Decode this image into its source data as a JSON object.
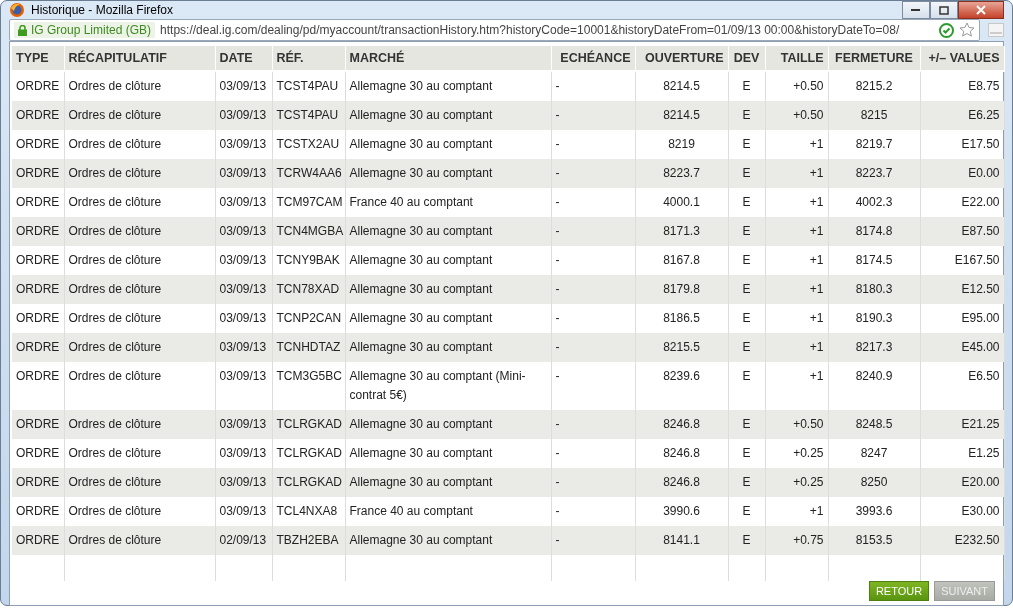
{
  "window": {
    "title": "Historique - Mozilla Firefox"
  },
  "address_bar": {
    "identity": "IG Group Limited (GB)",
    "url": "https://deal.ig.com/dealing/pd/myaccount/transactionHistory.htm?historyCode=10001&historyDateFrom=01/09/13 00:00&historyDateTo=08/"
  },
  "table": {
    "columns": [
      "TYPE",
      "RÉCAPITULATIF",
      "DATE",
      "RÉF.",
      "MARCHÉ",
      "ECHÉANCE",
      "OUVERTURE",
      "DEV",
      "TAILLE",
      "FERMETURE",
      "+/– VALUES"
    ],
    "rows": [
      [
        "ORDRE",
        "Ordres de clôture",
        "03/09/13",
        "TCST4PAU",
        "Allemagne 30 au comptant",
        "-",
        "8214.5",
        "E",
        "+0.50",
        "8215.2",
        "E8.75"
      ],
      [
        "ORDRE",
        "Ordres de clôture",
        "03/09/13",
        "TCST4PAU",
        "Allemagne 30 au comptant",
        "-",
        "8214.5",
        "E",
        "+0.50",
        "8215",
        "E6.25"
      ],
      [
        "ORDRE",
        "Ordres de clôture",
        "03/09/13",
        "TCSTX2AU",
        "Allemagne 30 au comptant",
        "-",
        "8219",
        "E",
        "+1",
        "8219.7",
        "E17.50"
      ],
      [
        "ORDRE",
        "Ordres de clôture",
        "03/09/13",
        "TCRW4AA6",
        "Allemagne 30 au comptant",
        "-",
        "8223.7",
        "E",
        "+1",
        "8223.7",
        "E0.00"
      ],
      [
        "ORDRE",
        "Ordres de clôture",
        "03/09/13",
        "TCM97CAM",
        "France 40 au comptant",
        "-",
        "4000.1",
        "E",
        "+1",
        "4002.3",
        "E22.00"
      ],
      [
        "ORDRE",
        "Ordres de clôture",
        "03/09/13",
        "TCN4MGBA",
        "Allemagne 30 au comptant",
        "-",
        "8171.3",
        "E",
        "+1",
        "8174.8",
        "E87.50"
      ],
      [
        "ORDRE",
        "Ordres de clôture",
        "03/09/13",
        "TCNY9BAK",
        "Allemagne 30 au comptant",
        "-",
        "8167.8",
        "E",
        "+1",
        "8174.5",
        "E167.50"
      ],
      [
        "ORDRE",
        "Ordres de clôture",
        "03/09/13",
        "TCN78XAD",
        "Allemagne 30 au comptant",
        "-",
        "8179.8",
        "E",
        "+1",
        "8180.3",
        "E12.50"
      ],
      [
        "ORDRE",
        "Ordres de clôture",
        "03/09/13",
        "TCNP2CAN",
        "Allemagne 30 au comptant",
        "-",
        "8186.5",
        "E",
        "+1",
        "8190.3",
        "E95.00"
      ],
      [
        "ORDRE",
        "Ordres de clôture",
        "03/09/13",
        "TCNHDTAZ",
        "Allemagne 30 au comptant",
        "-",
        "8215.5",
        "E",
        "+1",
        "8217.3",
        "E45.00"
      ],
      [
        "ORDRE",
        "Ordres de clôture",
        "03/09/13",
        "TCM3G5BC",
        "Allemagne 30 au comptant (Mini-contrat 5€)",
        "-",
        "8239.6",
        "E",
        "+1",
        "8240.9",
        "E6.50"
      ],
      [
        "ORDRE",
        "Ordres de clôture",
        "03/09/13",
        "TCLRGKAD",
        "Allemagne 30 au comptant",
        "-",
        "8246.8",
        "E",
        "+0.50",
        "8248.5",
        "E21.25"
      ],
      [
        "ORDRE",
        "Ordres de clôture",
        "03/09/13",
        "TCLRGKAD",
        "Allemagne 30 au comptant",
        "-",
        "8246.8",
        "E",
        "+0.25",
        "8247",
        "E1.25"
      ],
      [
        "ORDRE",
        "Ordres de clôture",
        "03/09/13",
        "TCLRGKAD",
        "Allemagne 30 au comptant",
        "-",
        "8246.8",
        "E",
        "+0.25",
        "8250",
        "E20.00"
      ],
      [
        "ORDRE",
        "Ordres de clôture",
        "03/09/13",
        "TCL4NXA8",
        "France 40 au comptant",
        "-",
        "3990.6",
        "E",
        "+1",
        "3993.6",
        "E30.00"
      ],
      [
        "ORDRE",
        "Ordres de clôture",
        "02/09/13",
        "TBZH2EBA",
        "Allemagne 30 au comptant",
        "-",
        "8141.1",
        "E",
        "+0.75",
        "8153.5",
        "E232.50"
      ]
    ]
  },
  "buttons": [
    {
      "label": "RETOUR",
      "disabled": false
    },
    {
      "label": "SUIVANT",
      "disabled": true
    }
  ]
}
